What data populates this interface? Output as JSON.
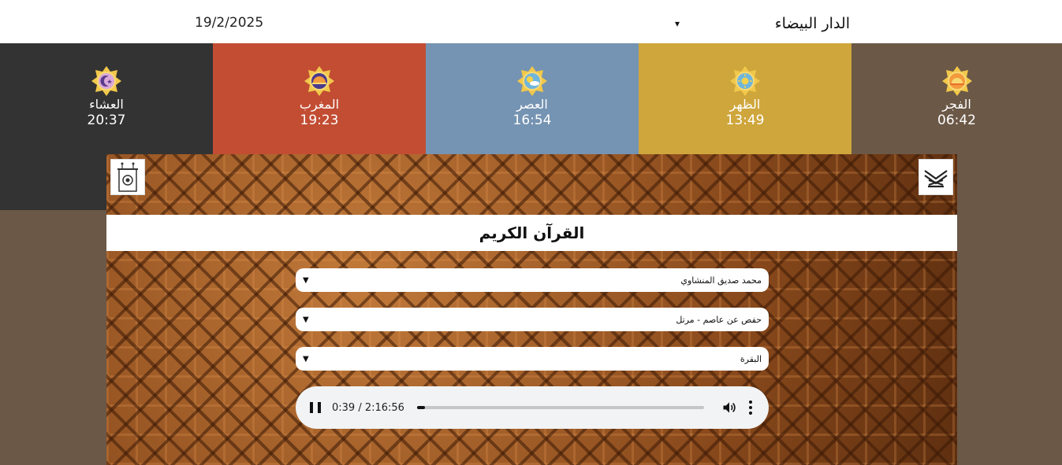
{
  "header": {
    "date": "19/2/2025",
    "city": "الدار البيضاء"
  },
  "prayers": [
    {
      "name": "العشاء",
      "time": "20:37",
      "color": "#333333",
      "icon": "crescent-star-badge-icon"
    },
    {
      "name": "المغرب",
      "time": "19:23",
      "color": "#c24d33",
      "icon": "sunset-badge-icon"
    },
    {
      "name": "العصر",
      "time": "16:54",
      "color": "#7593b2",
      "icon": "afternoon-sun-badge-icon"
    },
    {
      "name": "الظهر",
      "time": "13:49",
      "color": "#cfa63c",
      "icon": "noon-sun-badge-icon"
    },
    {
      "name": "الفجر",
      "time": "06:42",
      "color": "#6b5847",
      "icon": "sunrise-badge-icon"
    }
  ],
  "quran": {
    "title": "القرآن الكريم",
    "reciter": "محمد صديق المنشاوي",
    "riwaya": "حفص عن عاصم - مرتل",
    "surah": "البقرة",
    "player": {
      "time": "0:39 / 2:16:56",
      "progress": 0.0048
    },
    "icons": {
      "left": "minbar-icon",
      "right": "quran-book-icon"
    }
  },
  "colors": {
    "badge_gold": "#f2c84b",
    "badge_blue": "#6fb5dc",
    "badge_purple": "#5a3a8a",
    "background": "#6b5847"
  }
}
